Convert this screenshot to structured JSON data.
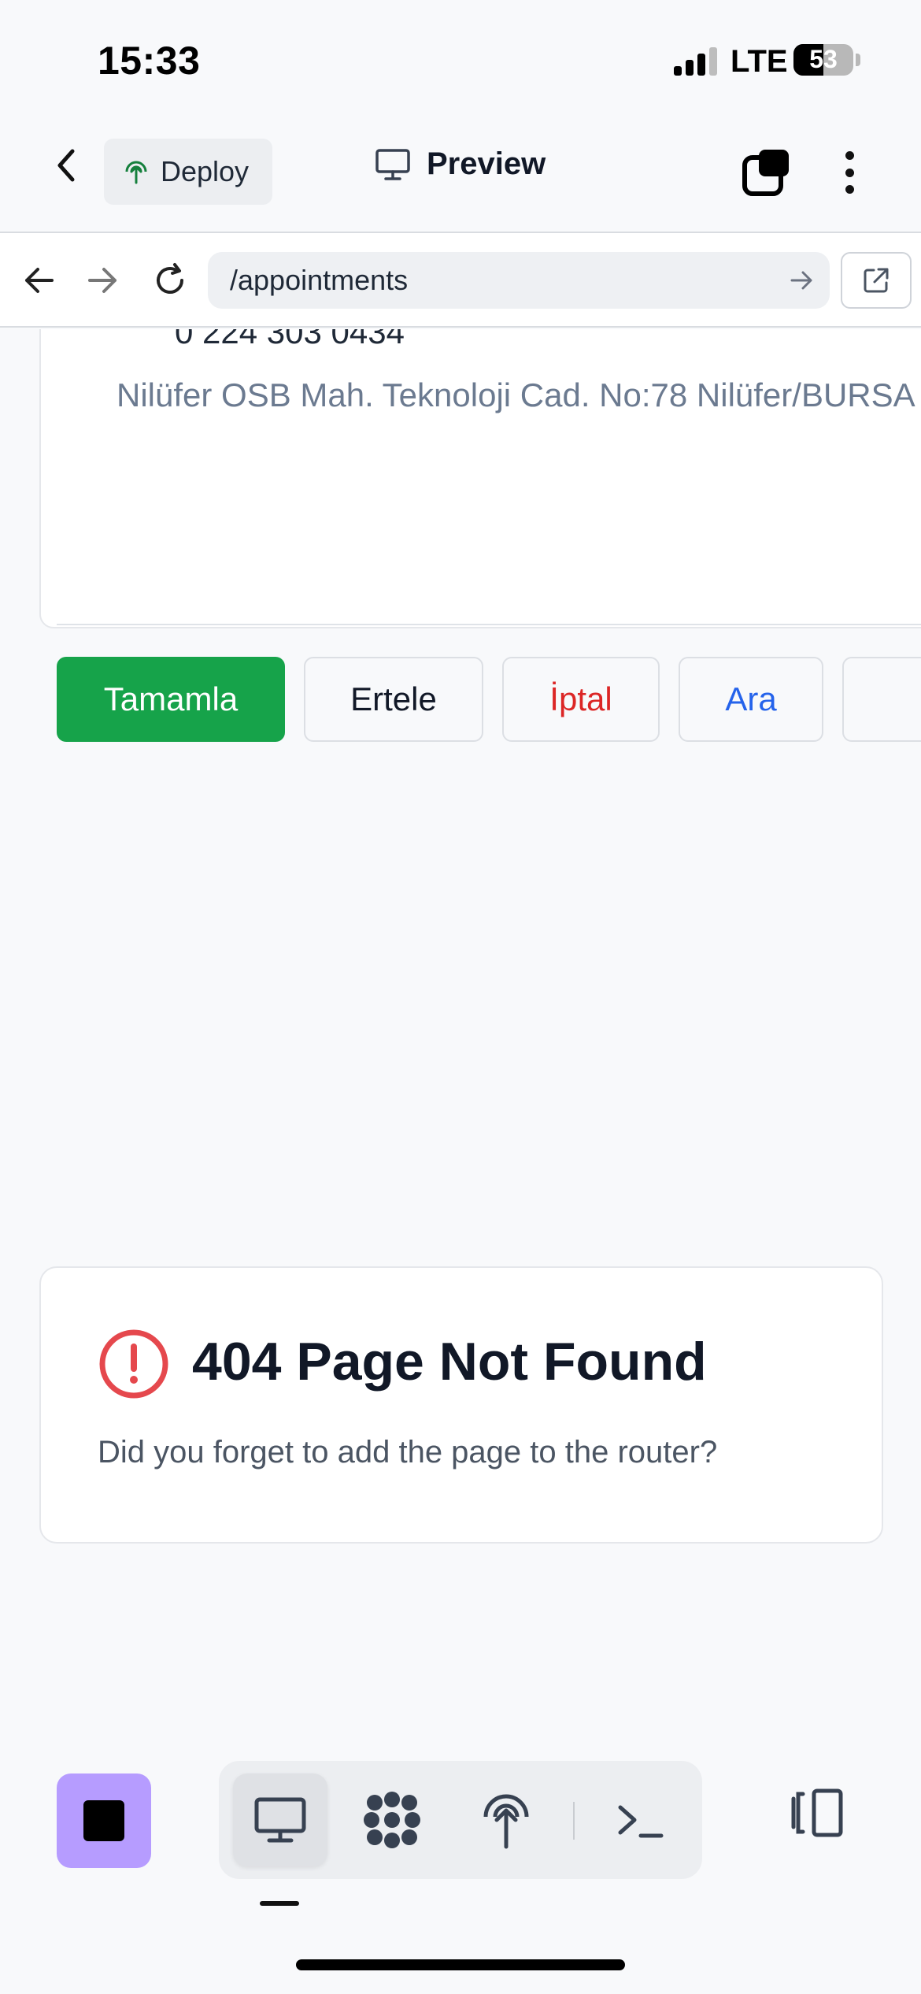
{
  "status_bar": {
    "time": "15:33",
    "network": "LTE",
    "battery": "53"
  },
  "header": {
    "deploy_label": "Deploy",
    "preview_label": "Preview"
  },
  "browser": {
    "url": "/appointments"
  },
  "appointment": {
    "phone_partial": "0 224 303 0434",
    "address": "Nilüfer OSB Mah. Teknoloji Cad. No:78 Nilüfer/BURSA",
    "actions": {
      "complete": "Tamamla",
      "postpone": "Ertele",
      "cancel": "İptal",
      "call": "Ara"
    }
  },
  "error": {
    "title": "404 Page Not Found",
    "description": "Did you forget to add the page to the router?"
  },
  "colors": {
    "complete": "#16a34a",
    "cancel": "#dc2626",
    "call": "#2563eb",
    "stop": "#b69cff",
    "error_icon": "#e5484d"
  },
  "toolbar": {
    "icons": [
      "stop-icon",
      "desktop-icon",
      "workspace-icon",
      "deploy-icon",
      "terminal-icon",
      "layout-toggle-icon"
    ]
  }
}
